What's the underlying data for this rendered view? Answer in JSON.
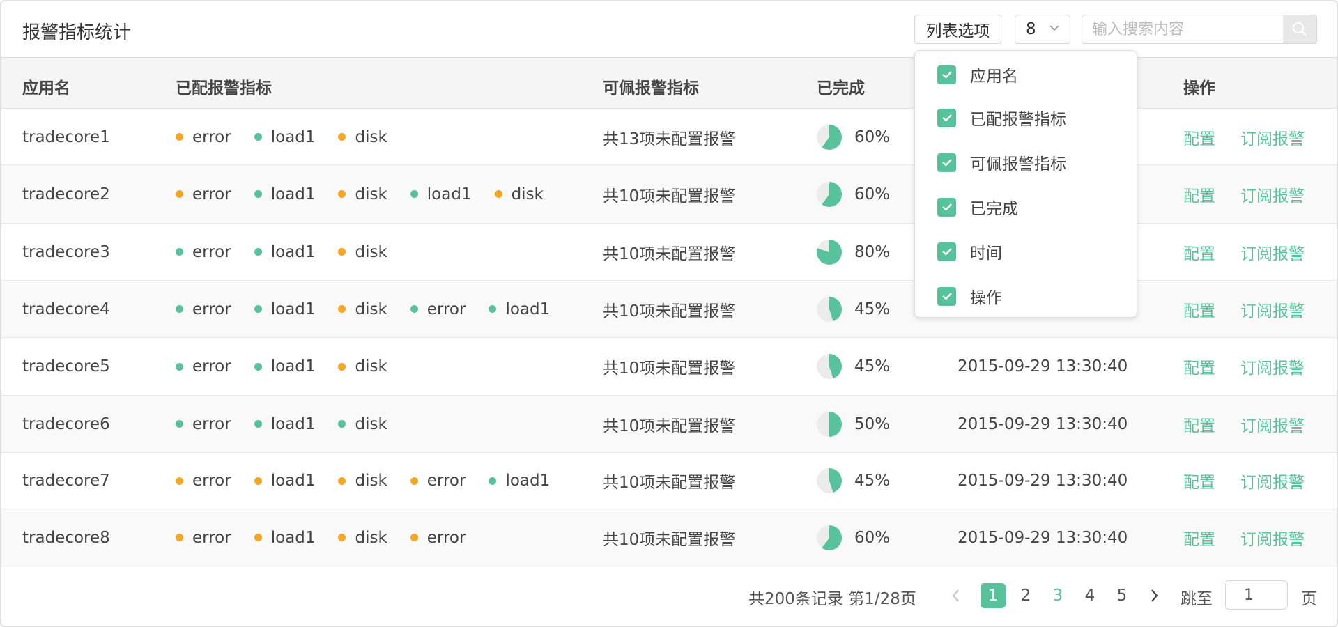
{
  "header": {
    "title": "报警指标统计",
    "list_options_label": "列表选项",
    "page_size": "8",
    "search_placeholder": "输入搜索内容"
  },
  "columns": [
    "应用名",
    "已配报警指标",
    "可佩报警指标",
    "已完成",
    "时间",
    "操作"
  ],
  "colors": {
    "accent": "#57c29b",
    "green_dot": "#57c29b",
    "orange_dot": "#f5a623"
  },
  "rows": [
    {
      "app": "tradecore1",
      "metrics": [
        {
          "name": "error",
          "status": "orange"
        },
        {
          "name": "load1",
          "status": "green"
        },
        {
          "name": "disk",
          "status": "orange"
        }
      ],
      "available": "共13项未配置报警",
      "done": "60%",
      "time": "",
      "actions": [
        "配置",
        "订阅报警"
      ]
    },
    {
      "app": "tradecore2",
      "metrics": [
        {
          "name": "error",
          "status": "orange"
        },
        {
          "name": "load1",
          "status": "green"
        },
        {
          "name": "disk",
          "status": "orange"
        },
        {
          "name": "load1",
          "status": "green"
        },
        {
          "name": "disk",
          "status": "orange"
        }
      ],
      "available": "共10项未配置报警",
      "done": "60%",
      "time": "",
      "actions": [
        "配置",
        "订阅报警"
      ]
    },
    {
      "app": "tradecore3",
      "metrics": [
        {
          "name": "error",
          "status": "green"
        },
        {
          "name": "load1",
          "status": "green"
        },
        {
          "name": "disk",
          "status": "orange"
        }
      ],
      "available": "共10项未配置报警",
      "done": "80%",
      "time": "",
      "actions": [
        "配置",
        "订阅报警"
      ]
    },
    {
      "app": "tradecore4",
      "metrics": [
        {
          "name": "error",
          "status": "green"
        },
        {
          "name": "load1",
          "status": "green"
        },
        {
          "name": "disk",
          "status": "orange"
        },
        {
          "name": "error",
          "status": "green"
        },
        {
          "name": "load1",
          "status": "green"
        }
      ],
      "available": "共10项未配置报警",
      "done": "45%",
      "time": "",
      "actions": [
        "配置",
        "订阅报警"
      ]
    },
    {
      "app": "tradecore5",
      "metrics": [
        {
          "name": "error",
          "status": "green"
        },
        {
          "name": "load1",
          "status": "green"
        },
        {
          "name": "disk",
          "status": "orange"
        }
      ],
      "available": "共10项未配置报警",
      "done": "45%",
      "time": "2015-09-29 13:30:40",
      "actions": [
        "配置",
        "订阅报警"
      ]
    },
    {
      "app": "tradecore6",
      "metrics": [
        {
          "name": "error",
          "status": "green"
        },
        {
          "name": "load1",
          "status": "green"
        },
        {
          "name": "disk",
          "status": "green"
        }
      ],
      "available": "共10项未配置报警",
      "done": "50%",
      "time": "2015-09-29 13:30:40",
      "actions": [
        "配置",
        "订阅报警"
      ]
    },
    {
      "app": "tradecore7",
      "metrics": [
        {
          "name": "error",
          "status": "orange"
        },
        {
          "name": "load1",
          "status": "orange"
        },
        {
          "name": "disk",
          "status": "orange"
        },
        {
          "name": "error",
          "status": "orange"
        },
        {
          "name": "load1",
          "status": "green"
        }
      ],
      "available": "共10项未配置报警",
      "done": "45%",
      "time": "2015-09-29 13:30:40",
      "actions": [
        "配置",
        "订阅报警"
      ]
    },
    {
      "app": "tradecore8",
      "metrics": [
        {
          "name": "error",
          "status": "orange"
        },
        {
          "name": "load1",
          "status": "orange"
        },
        {
          "name": "disk",
          "status": "orange"
        },
        {
          "name": "error",
          "status": "orange"
        }
      ],
      "available": "共10项未配置报警",
      "done": "60%",
      "time": "2015-09-29 13:30:40",
      "actions": [
        "配置",
        "订阅报警"
      ]
    }
  ],
  "dropdown": {
    "items": [
      {
        "label": "应用名",
        "checked": true
      },
      {
        "label": "已配报警指标",
        "checked": true
      },
      {
        "label": "可佩报警指标",
        "checked": true
      },
      {
        "label": "已完成",
        "checked": true
      },
      {
        "label": "时间",
        "checked": true
      },
      {
        "label": "操作",
        "checked": true
      }
    ]
  },
  "pagination": {
    "summary": "共200条记录 第1/28页",
    "pages": [
      "1",
      "2",
      "3",
      "4",
      "5"
    ],
    "current": "1",
    "highlighted": "3",
    "jump_label": "跳至",
    "jump_value": "1",
    "page_unit": "页"
  }
}
